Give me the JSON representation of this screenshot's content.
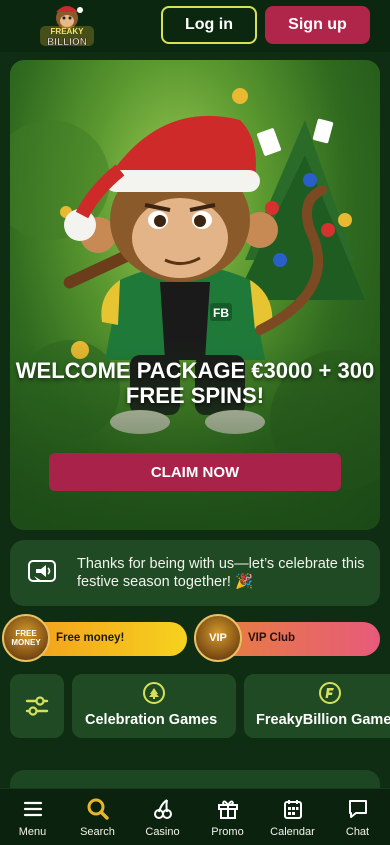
{
  "header": {
    "logo_text_line1": "FREAKY",
    "logo_text_line2": "BILLION",
    "login_label": "Log in",
    "signup_label": "Sign up"
  },
  "hero": {
    "title": "WELCOME PACKAGE €3000 + 300 FREE SPINS!",
    "cta_label": "CLAIM NOW",
    "jacket_text": "FB"
  },
  "notice": {
    "text": "Thanks for being with us—let’s celebrate this festive season together! 🎉"
  },
  "promos": [
    {
      "label": "Free money!",
      "badge_text": "FREE MONEY"
    },
    {
      "label": "VIP Club",
      "badge_text": "VIP"
    }
  ],
  "categories": [
    {
      "label": "Celebration Games",
      "icon": "tree-icon"
    },
    {
      "label": "FreakyBillion Games",
      "icon": "freakybillion-coin-icon"
    }
  ],
  "bottom_nav": [
    {
      "label": "Menu",
      "icon": "menu-icon"
    },
    {
      "label": "Search",
      "icon": "search-icon"
    },
    {
      "label": "Casino",
      "icon": "cherries-icon"
    },
    {
      "label": "Promo",
      "icon": "gift-icon"
    },
    {
      "label": "Calendar",
      "icon": "calendar-icon"
    },
    {
      "label": "Chat",
      "icon": "chat-icon"
    }
  ],
  "colors": {
    "background": "#0f2d12",
    "primary_button": "#b0254a",
    "accent_outline": "#d8e05a",
    "card": "#1f4a24",
    "search_accent": "#e7b62d"
  }
}
